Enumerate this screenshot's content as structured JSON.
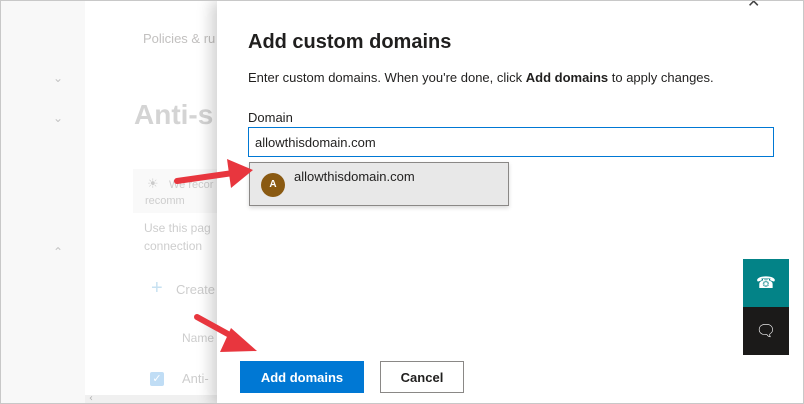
{
  "background": {
    "breadcrumb": "Policies & ru",
    "page_title": "Anti-s",
    "notice_line1": "We recor",
    "notice_line2": "recomm",
    "desc_line1": "Use this pag",
    "desc_line2": "connection",
    "create_label": "Create",
    "name_header": "Name",
    "row_label": "Anti-",
    "chevron_icon": "chevron-down-icon",
    "bulb_icon": "lightbulb-icon"
  },
  "panel": {
    "title": "Add custom domains",
    "description_prefix": "Enter custom domains. When you're done, click ",
    "description_bold": "Add domains",
    "description_suffix": " to apply changes.",
    "field_label": "Domain",
    "field_value": "allowthisdomain.com",
    "suggestion": {
      "avatar_letter": "A",
      "text": "allowthisdomain.com"
    },
    "primary_button": "Add domains",
    "secondary_button": "Cancel"
  },
  "widgets": {
    "help_icon": "headset-icon",
    "feedback_icon": "chat-icon"
  },
  "colors": {
    "accent": "#0078d4",
    "annotation_arrow": "#e8363e",
    "help_widget": "#038387",
    "feedback_widget": "#1b1a19"
  }
}
